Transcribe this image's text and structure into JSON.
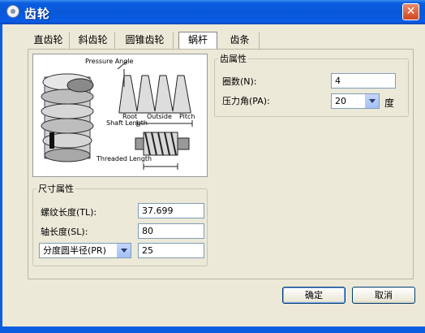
{
  "window": {
    "title": "齿轮",
    "close_label": "✕"
  },
  "tabs": [
    {
      "label": "直齿轮",
      "active": false
    },
    {
      "label": "斜齿轮",
      "active": false
    },
    {
      "label": "圆锥齿轮",
      "active": false
    },
    {
      "label": "蜗杆",
      "active": true
    },
    {
      "label": "齿条",
      "active": false
    }
  ],
  "diagram": {
    "pressure_angle_label": "Pressure Angle",
    "root_label": "Root",
    "outside_label": "Outside",
    "pitch_label": "Pitch",
    "shaft_length_label": "Shaft Length",
    "threaded_length_label": "Threaded Length"
  },
  "gear_props": {
    "legend": "齿属性",
    "teeth_label": "圈数(N):",
    "teeth_value": "4",
    "pressure_angle_label": "压力角(PA):",
    "pressure_angle_value": "20",
    "pressure_angle_unit": "度"
  },
  "size_props": {
    "legend": "尺寸属性",
    "thread_length_label": "螺纹长度(TL):",
    "thread_length_value": "37.699",
    "shaft_length_label": "轴长度(SL):",
    "shaft_length_value": "80",
    "radius_select_label": "分度圆半径(PR)",
    "radius_value": "25"
  },
  "buttons": {
    "ok": "确定",
    "cancel": "取消"
  }
}
